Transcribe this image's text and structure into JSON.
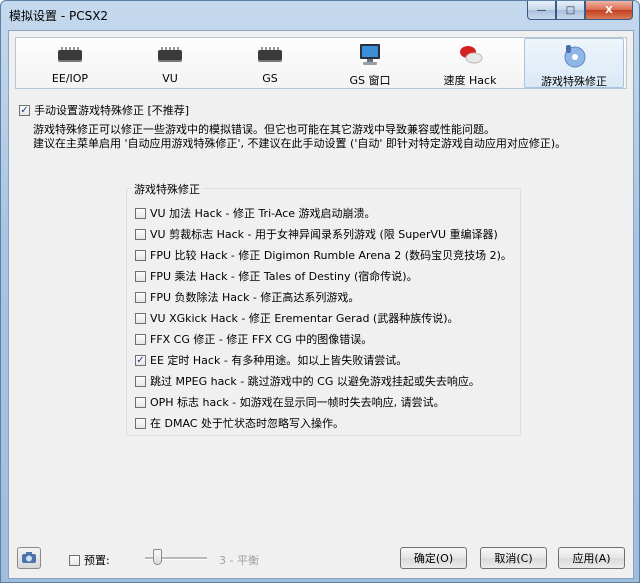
{
  "window": {
    "title": "模拟设置 - PCSX2",
    "min": "—",
    "max": "□",
    "close": "X"
  },
  "tabs": [
    {
      "label": "EE/IOP",
      "icon": "chip-icon"
    },
    {
      "label": "VU",
      "icon": "chip-icon"
    },
    {
      "label": "GS",
      "icon": "chip-icon"
    },
    {
      "label": "GS 窗口",
      "icon": "monitor-icon"
    },
    {
      "label": "速度 Hack",
      "icon": "pill-icon"
    },
    {
      "label": "游戏特殊修正",
      "icon": "disc-icon"
    }
  ],
  "manual": {
    "checkbox_label": "手动设置游戏特殊修正 [不推荐]",
    "checked": true,
    "desc1": "游戏特殊修正可以修正一些游戏中的模拟错误。但它也可能在其它游戏中导致兼容或性能问题。",
    "desc2": "建议在主菜单启用 '自动应用游戏特殊修正', 不建议在此手动设置 ('自动' 即针对特定游戏自动应用对应修正)。"
  },
  "group": {
    "title": "游戏特殊修正",
    "items": [
      {
        "label": "VU 加法 Hack - 修正 Tri-Ace 游戏启动崩溃。",
        "checked": false
      },
      {
        "label": "VU 剪裁标志 Hack - 用于女神异闻录系列游戏 (限 SuperVU 重编译器)",
        "checked": false
      },
      {
        "label": "FPU 比较 Hack - 修正 Digimon Rumble Arena 2 (数码宝贝竞技场 2)。",
        "checked": false
      },
      {
        "label": "FPU 乘法 Hack - 修正 Tales of Destiny (宿命传说)。",
        "checked": false
      },
      {
        "label": "FPU 负数除法 Hack - 修正高达系列游戏。",
        "checked": false
      },
      {
        "label": "VU XGkick Hack - 修正 Erementar Gerad (武器种族传说)。",
        "checked": false
      },
      {
        "label": "FFX CG 修正 - 修正 FFX CG 中的图像错误。",
        "checked": false
      },
      {
        "label": "EE 定时 Hack - 有多种用途。如以上皆失败请尝试。",
        "checked": true
      },
      {
        "label": "跳过 MPEG hack - 跳过游戏中的 CG 以避免游戏挂起或失去响应。",
        "checked": false
      },
      {
        "label": "OPH 标志 hack - 如游戏在显示同一帧时失去响应, 请尝试。",
        "checked": false
      },
      {
        "label": "在 DMAC 处于忙状态时忽略写入操作。",
        "checked": false
      }
    ]
  },
  "bottom": {
    "preset_label": "预置:",
    "preset_checked": false,
    "slider_value": 3,
    "slider_text": "3 - 平衡",
    "ok": "确定(O)",
    "cancel": "取消(C)",
    "apply": "应用(A)"
  }
}
